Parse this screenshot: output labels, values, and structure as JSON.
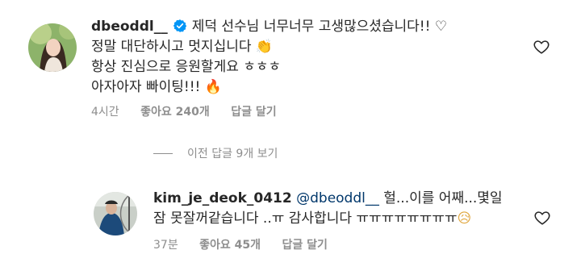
{
  "comment": {
    "username": "dbeoddl__",
    "verified_icon": "verified-badge-icon",
    "lines": [
      "제덕 선수님 너무너무 고생많으셨습니다!! ♡",
      "정말 대단하시고 멋지십니다 ",
      "항상 진심으로 응원할게요 ㅎㅎㅎ",
      "아자아자 빠이팅!!! "
    ],
    "emoji_clap": "👏",
    "emoji_fire": "🔥",
    "time": "4시간",
    "likes": "좋아요 240개",
    "reply_label": "답글 달기",
    "like_icon": "heart-outline-icon"
  },
  "view_replies": {
    "label": "이전 답글 9개 보기"
  },
  "reply": {
    "username": "kim_je_deok_0412",
    "mention": "@dbeoddl__",
    "text_line1": " 헐...이를 어째...몇일",
    "text_line2": "잠 못잘꺼같습니다 ..ㅠ 감사합니다 ㅠㅠㅠㅠㅠㅠㅠㅠ",
    "emoji_sad": "😥",
    "time": "37분",
    "likes": "좋아요 45개",
    "reply_label": "답글 달기",
    "like_icon": "heart-outline-icon"
  },
  "colors": {
    "text": "#262626",
    "secondary": "#8e8e8e",
    "mention": "#00376b",
    "verified": "#0095f6"
  }
}
